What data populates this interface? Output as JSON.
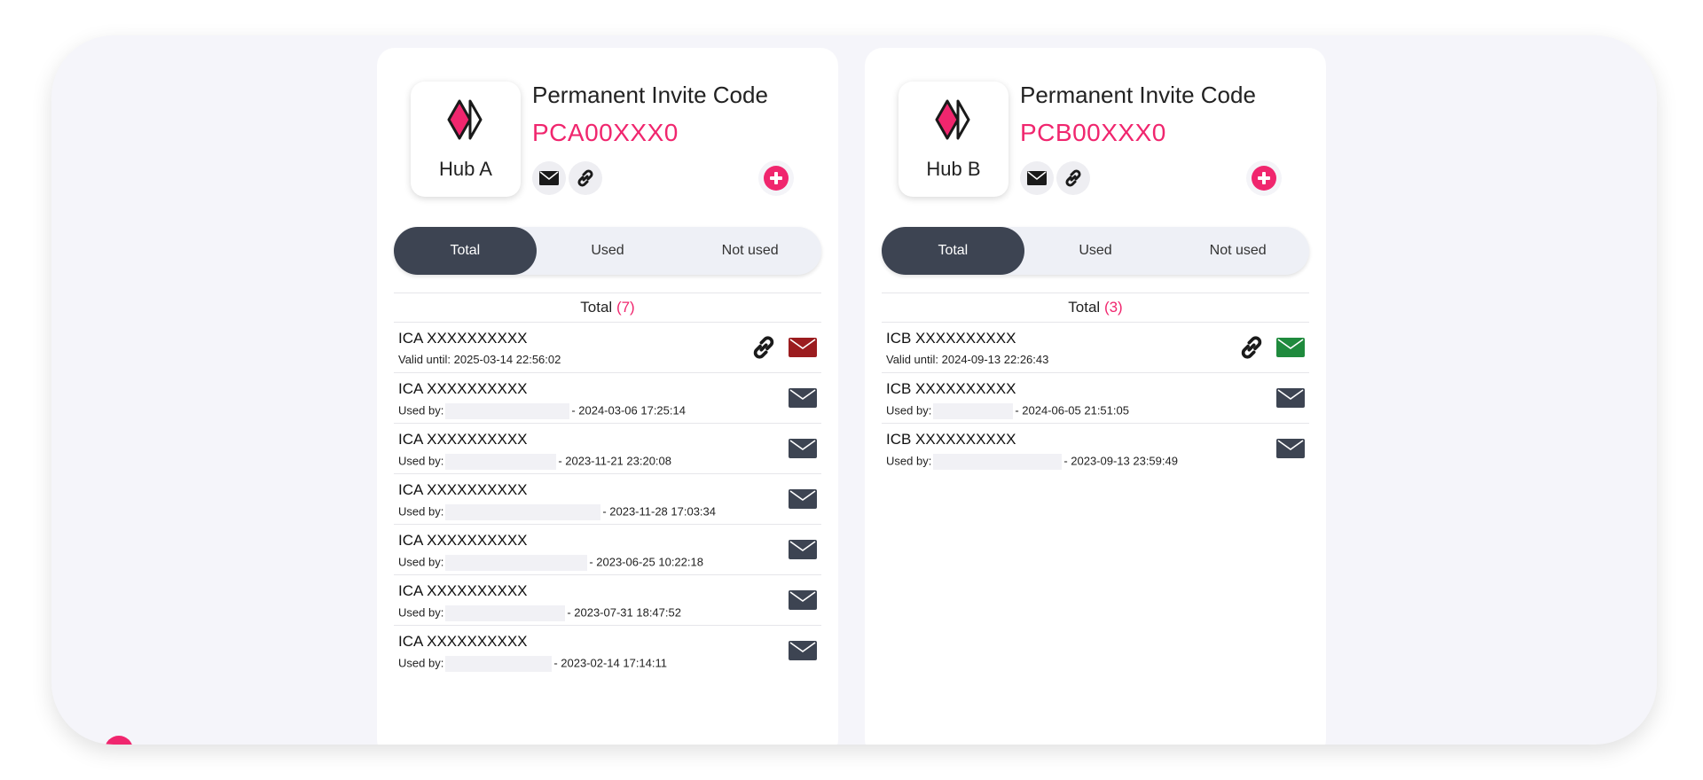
{
  "colors": {
    "accent": "#f0266e",
    "dark": "#3d4452",
    "mail_red": "#9b1c1f",
    "mail_green": "#1f8a3d"
  },
  "hubs": [
    {
      "name": "Hub A",
      "invite_title": "Permanent Invite Code",
      "invite_code": "PCA00XXX0",
      "tabs": [
        "Total",
        "Used",
        "Not used"
      ],
      "active_tab": "Total",
      "list_label": "Total",
      "list_count": "(7)",
      "rows": [
        {
          "code": "ICA XXXXXXXXXX",
          "sub_label": "Valid until:",
          "sub_value": "2025-03-14 22:56:02",
          "has_link": true,
          "mail": "red"
        },
        {
          "code": "ICA XXXXXXXXXX",
          "sub_label": "Used by:",
          "sub_value": "- 2024-03-06 17:25:14",
          "has_link": false,
          "mail": "dark"
        },
        {
          "code": "ICA XXXXXXXXXX",
          "sub_label": "Used by:",
          "sub_value": "- 2023-11-21 23:20:08",
          "has_link": false,
          "mail": "dark"
        },
        {
          "code": "ICA XXXXXXXXXX",
          "sub_label": "Used by:",
          "sub_value": "- 2023-11-28 17:03:34",
          "has_link": false,
          "mail": "dark"
        },
        {
          "code": "ICA XXXXXXXXXX",
          "sub_label": "Used by:",
          "sub_value": "- 2023-06-25 10:22:18",
          "has_link": false,
          "mail": "dark"
        },
        {
          "code": "ICA XXXXXXXXXX",
          "sub_label": "Used by:",
          "sub_value": "- 2023-07-31 18:47:52",
          "has_link": false,
          "mail": "dark"
        },
        {
          "code": "ICA XXXXXXXXXX",
          "sub_label": "Used by:",
          "sub_value": "- 2023-02-14 17:14:11",
          "has_link": false,
          "mail": "dark"
        }
      ]
    },
    {
      "name": "Hub B",
      "invite_title": "Permanent Invite Code",
      "invite_code": "PCB00XXX0",
      "tabs": [
        "Total",
        "Used",
        "Not used"
      ],
      "active_tab": "Total",
      "list_label": "Total",
      "list_count": "(3)",
      "rows": [
        {
          "code": "ICB XXXXXXXXXX",
          "sub_label": "Valid until:",
          "sub_value": "2024-09-13 22:26:43",
          "has_link": true,
          "mail": "green"
        },
        {
          "code": "ICB XXXXXXXXXX",
          "sub_label": "Used by:",
          "sub_value": "- 2024-06-05 21:51:05",
          "has_link": false,
          "mail": "dark"
        },
        {
          "code": "ICB XXXXXXXXXX",
          "sub_label": "Used by:",
          "sub_value": "- 2023-09-13 23:59:49",
          "has_link": false,
          "mail": "dark"
        }
      ]
    }
  ]
}
